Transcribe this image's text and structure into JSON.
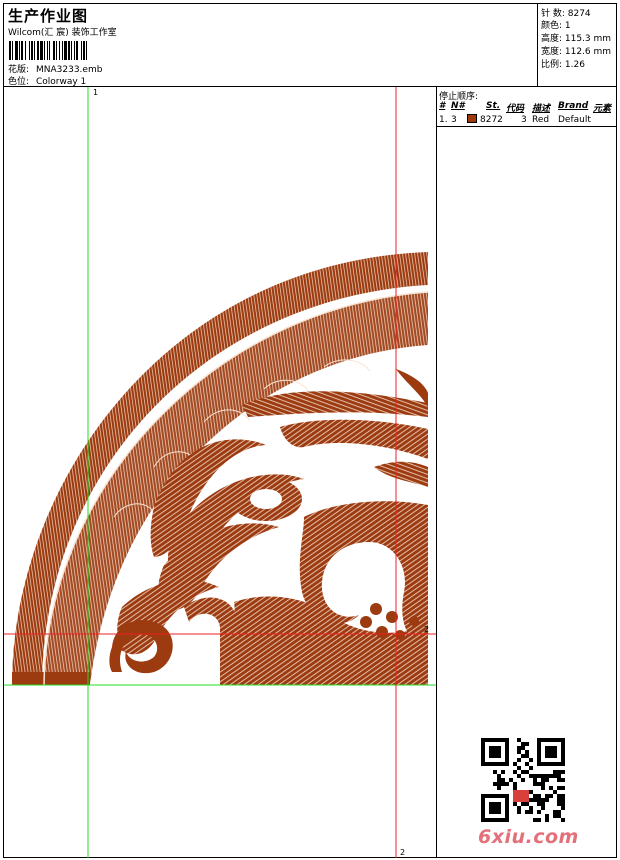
{
  "header": {
    "title": "生产作业图",
    "company": "Wilcom(汇 宸) 装饰工作室",
    "design_label": "花版:",
    "design_value": "MNA3233.emb",
    "colorway_label": "色位:",
    "colorway_value": "Colorway 1"
  },
  "stats": {
    "stitches": "针 数: 8274",
    "colors": "颜色: 1",
    "height": "高度: 115.3 mm",
    "width": "宽度: 112.6 mm",
    "scale": "比例: 1.26"
  },
  "stop_sequence": {
    "caption": "停止顺序:",
    "columns": [
      "#",
      "N#",
      "St.",
      "代码",
      "描述",
      "Brand",
      "元素"
    ],
    "rows": [
      {
        "index": "1.",
        "needle": "3",
        "stitches": "8272",
        "code": "3",
        "description": "Red",
        "brand": "Default",
        "swatch_color": "#a03a0c"
      }
    ]
  },
  "guides": {
    "label_1": "1",
    "label_2_right": "2",
    "label_2_bottom": "2"
  },
  "colors": {
    "thread": "#9c3a10",
    "guide_green": "#22dd22",
    "guide_red": "#ee2020"
  },
  "watermark": "6xiu.com"
}
